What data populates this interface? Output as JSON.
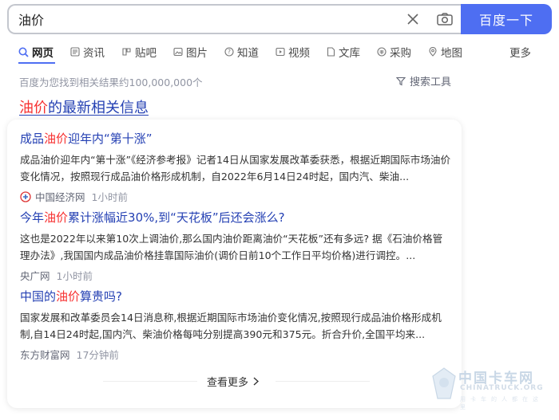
{
  "search": {
    "query": "油价",
    "button_label": "百度一下"
  },
  "tabs": [
    {
      "label": "网页",
      "icon": "search-icon",
      "active": true
    },
    {
      "label": "资讯",
      "icon": "news-icon"
    },
    {
      "label": "贴吧",
      "icon": "tieba-icon"
    },
    {
      "label": "图片",
      "icon": "image-icon"
    },
    {
      "label": "知道",
      "icon": "question-icon"
    },
    {
      "label": "视频",
      "icon": "video-icon"
    },
    {
      "label": "文库",
      "icon": "document-icon"
    },
    {
      "label": "采购",
      "icon": "cart-icon"
    },
    {
      "label": "地图",
      "icon": "map-icon"
    }
  ],
  "tab_more": "更多",
  "result_count": "百度为您找到相关结果约100,000,000个",
  "search_tools": "搜索工具",
  "section_heading": {
    "highlight": "油价",
    "rest": "的最新相关信息"
  },
  "news_items": [
    {
      "title_pre": "成品",
      "title_hl": "油价",
      "title_post": "迎年内“第十涨”",
      "snippet": "成品油价迎年内“第十涨”《经济参考报》记者14日从国家发展改革委获悉，根据近期国际市场油价变化情况，按照现行成品油价格形成机制，自2022年6月14日24时起，国内汽、柴油...",
      "source": "中国经济网",
      "time": "1小时前",
      "has_logo": true
    },
    {
      "title_pre": "今年",
      "title_hl": "油价",
      "title_post": "累计涨幅近30%,到“天花板”后还会涨么?",
      "snippet": "这也是2022年以来第10次上调油价,那么国内油价距离油价“天花板”还有多远? 据《石油价格管理办法》,我国国内成品油价格挂靠国际油价(调价日前10个工作日平均价格)进行调控。...",
      "source": "央广网",
      "time": "1小时前",
      "has_logo": false
    },
    {
      "title_pre": "中国的",
      "title_hl": "油价",
      "title_post": "算贵吗?",
      "snippet": "国家发展和改革委员会14日消息称,根据近期国际市场油价变化情况,按照现行成品油价格形成机制,自14日24时起,国内汽、柴油价格每吨分别提高390元和375元。折合升价,全国平均来...",
      "source": "东方财富网",
      "time": "17分钟前",
      "has_logo": false
    }
  ],
  "more_label": "查看更多",
  "watermark": {
    "title": "中国卡车网",
    "sub": "CHINATRUCK.ORG",
    "tag": "用卡车的人都在这里"
  },
  "colors": {
    "accent": "#4e6ef2",
    "link": "#2440b3",
    "highlight": "#f73131"
  }
}
